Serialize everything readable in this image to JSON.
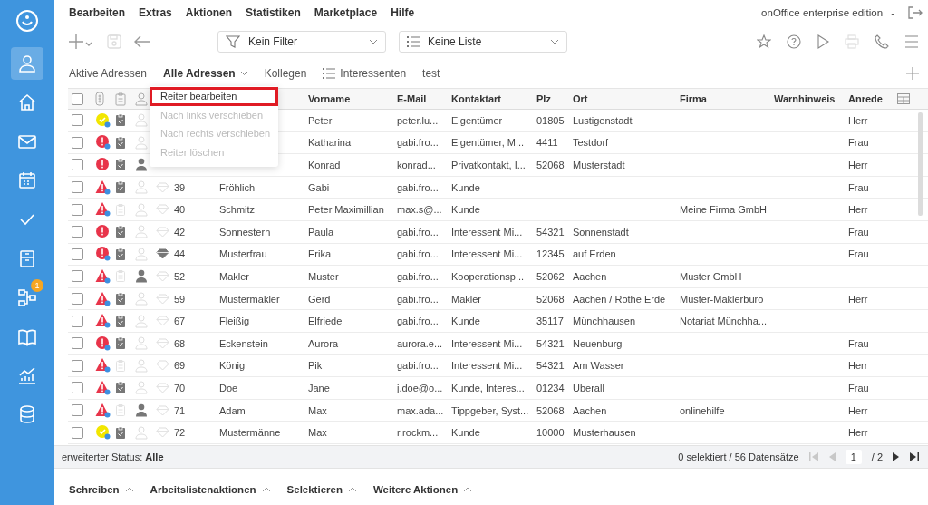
{
  "menu_bar": {
    "items": [
      "Bearbeiten",
      "Extras",
      "Aktionen",
      "Statistiken",
      "Marketplace",
      "Hilfe"
    ],
    "edition": "onOffice enterprise edition",
    "separator": "-"
  },
  "sidebar": {
    "items": [
      {
        "selected": true
      },
      {
        "selected": false
      },
      {
        "selected": false
      },
      {
        "selected": false
      },
      {
        "selected": false
      },
      {
        "selected": false
      },
      {
        "selected": false,
        "badge": "1"
      },
      {
        "selected": false
      },
      {
        "selected": false
      },
      {
        "selected": false
      }
    ]
  },
  "toolbar": {
    "filter": {
      "value": "Kein Filter"
    },
    "list": {
      "value": "Keine Liste"
    },
    "save_disabled": true,
    "print_disabled": true
  },
  "tabs": [
    {
      "label": "Aktive Adressen",
      "selected": false,
      "kind": "plain"
    },
    {
      "label": "Alle Adressen",
      "selected": true,
      "kind": "plain"
    },
    {
      "label": "Kollegen",
      "selected": false,
      "kind": "plain"
    },
    {
      "label": "Interessenten",
      "selected": false,
      "kind": "list"
    },
    {
      "label": "test",
      "selected": false,
      "kind": "plain"
    }
  ],
  "tab_menu": [
    {
      "label": "Reiter bearbeiten",
      "disabled": false,
      "selected": true
    },
    {
      "label": "Nach links verschieben",
      "disabled": true,
      "selected": false
    },
    {
      "label": "Nach rechts verschieben",
      "disabled": true,
      "selected": false
    },
    {
      "label": "Reiter löschen",
      "disabled": true,
      "selected": false
    }
  ],
  "table": {
    "select_all_checked": false,
    "columns": {
      "vorname": "Vorname",
      "e_mail": "E-Mail",
      "kontaktart": "Kontaktart",
      "plz": "Plz",
      "ort": "Ort",
      "firma": "Firma",
      "warnhinweis": "Warnhinweis",
      "anrede": "Anrede"
    },
    "rows": [
      {
        "checked": false,
        "kind": "ok",
        "dot": true,
        "clipboard": true,
        "person": false,
        "vorname": "Peter",
        "e_mail": "peter.lu...",
        "kontaktart": "Eigentümer",
        "plz": "01805",
        "ort": "Lustigenstadt",
        "anrede": "Herr"
      },
      {
        "checked": false,
        "kind": "exclamation",
        "dot": true,
        "clipboard": true,
        "person": false,
        "vorname": "Katharina",
        "e_mail": "gabi.fro...",
        "kontaktart": "Eigentümer, M...",
        "plz": "4411",
        "ort": "Testdorf",
        "anrede": "Frau"
      },
      {
        "checked": false,
        "kind": "exclamation",
        "dot": false,
        "clipboard": true,
        "person": true,
        "vorname": "Konrad",
        "e_mail": "konrad...",
        "kontaktart": "Privatkontakt, I...",
        "plz": "52068",
        "ort": "Musterstadt",
        "anrede": "Herr"
      },
      {
        "checked": false,
        "kind": "warning",
        "dot": true,
        "clipboard": true,
        "person": false,
        "diamond": false,
        "column_1": "39",
        "column_2": "Fröhlich",
        "vorname": "Gabi",
        "e_mail": "gabi.fro...",
        "kontaktart": "Kunde",
        "anrede": "Frau"
      },
      {
        "checked": false,
        "kind": "warning",
        "dot": true,
        "clipboard": false,
        "person": false,
        "diamond": false,
        "column_1": "40",
        "column_2": "Schmitz",
        "vorname": "Peter Maximillian",
        "e_mail": "max.s@...",
        "kontaktart": "Kunde",
        "firma": "Meine Firma GmbH",
        "anrede": "Herr"
      },
      {
        "checked": false,
        "kind": "exclamation",
        "dot": false,
        "clipboard": true,
        "person": false,
        "diamond": false,
        "column_1": "42",
        "column_2": "Sonnestern",
        "vorname": "Paula",
        "e_mail": "gabi.fro...",
        "kontaktart": "Interessent Mi...",
        "plz": "54321",
        "ort": "Sonnenstadt",
        "anrede": "Frau"
      },
      {
        "checked": false,
        "kind": "exclamation",
        "dot": true,
        "clipboard": true,
        "person": false,
        "diamond": true,
        "column_1": "44",
        "column_2": "Musterfrau",
        "vorname": "Erika",
        "e_mail": "gabi.fro...",
        "kontaktart": "Interessent Mi...",
        "plz": "12345",
        "ort": "auf Erden",
        "anrede": "Frau"
      },
      {
        "checked": false,
        "kind": "warning",
        "dot": true,
        "clipboard": false,
        "person": true,
        "diamond": false,
        "column_1": "52",
        "column_2": "Makler",
        "vorname": "Muster",
        "e_mail": "gabi.fro...",
        "kontaktart": "Kooperationsp...",
        "plz": "52062",
        "ort": "Aachen",
        "firma": "Muster GmbH"
      },
      {
        "checked": false,
        "kind": "warning",
        "dot": true,
        "clipboard": true,
        "person": false,
        "diamond": false,
        "column_1": "59",
        "column_2": "Mustermakler",
        "vorname": "Gerd",
        "e_mail": "gabi.fro...",
        "kontaktart": "Makler",
        "plz": "52068",
        "ort": "Aachen / Rothe Erde",
        "firma": "Muster-Maklerbüro",
        "anrede": "Herr"
      },
      {
        "checked": false,
        "kind": "warning",
        "dot": true,
        "clipboard": true,
        "person": false,
        "diamond": false,
        "column_1": "67",
        "column_2": "Fleißig",
        "vorname": "Elfriede",
        "e_mail": "gabi.fro...",
        "kontaktart": "Kunde",
        "plz": "35117",
        "ort": "Münchhausen",
        "firma": "Notariat Münchha..."
      },
      {
        "checked": false,
        "kind": "exclamation",
        "dot": true,
        "clipboard": true,
        "person": false,
        "diamond": false,
        "column_1": "68",
        "column_2": "Eckenstein",
        "vorname": "Aurora",
        "e_mail": "aurora.e...",
        "kontaktart": "Interessent Mi...",
        "plz": "54321",
        "ort": "Neuenburg",
        "anrede": "Frau"
      },
      {
        "checked": false,
        "kind": "warning",
        "dot": true,
        "clipboard": false,
        "person": false,
        "diamond": false,
        "column_1": "69",
        "column_2": "König",
        "vorname": "Pik",
        "e_mail": "gabi.fro...",
        "kontaktart": "Interessent Mi...",
        "plz": "54321",
        "ort": "Am Wasser",
        "anrede": "Herr"
      },
      {
        "checked": false,
        "kind": "warning",
        "dot": true,
        "clipboard": true,
        "person": false,
        "diamond": false,
        "column_1": "70",
        "column_2": "Doe",
        "vorname": "Jane",
        "e_mail": "j.doe@o...",
        "kontaktart": "Kunde, Interes...",
        "plz": "01234",
        "ort": "Überall",
        "anrede": "Frau"
      },
      {
        "checked": false,
        "kind": "warning",
        "dot": true,
        "clipboard": false,
        "person": true,
        "diamond": false,
        "column_1": "71",
        "column_2": "Adam",
        "vorname": "Max",
        "e_mail": "max.ada...",
        "kontaktart": "Tippgeber, Syst...",
        "plz": "52068",
        "ort": "Aachen",
        "firma": "onlinehilfe",
        "anrede": "Herr"
      },
      {
        "checked": false,
        "kind": "ok",
        "dot": true,
        "clipboard": true,
        "person": false,
        "diamond": false,
        "column_1": "72",
        "column_2": "Mustermänne",
        "vorname": "Max",
        "e_mail": "r.rockm...",
        "kontaktart": "Kunde",
        "plz": "10000",
        "ort": "Musterhausen",
        "anrede": "Herr"
      }
    ]
  },
  "status_bar": {
    "status": "erweiterter Status: **Alle**",
    "count": "0 selektiert / 56 Datensätze",
    "page": "1",
    "pages": "/ 2"
  },
  "actions": [
    "Schreiben",
    "Arbeitslistenaktionen",
    "Selektieren",
    "Weitere Aktionen"
  ]
}
